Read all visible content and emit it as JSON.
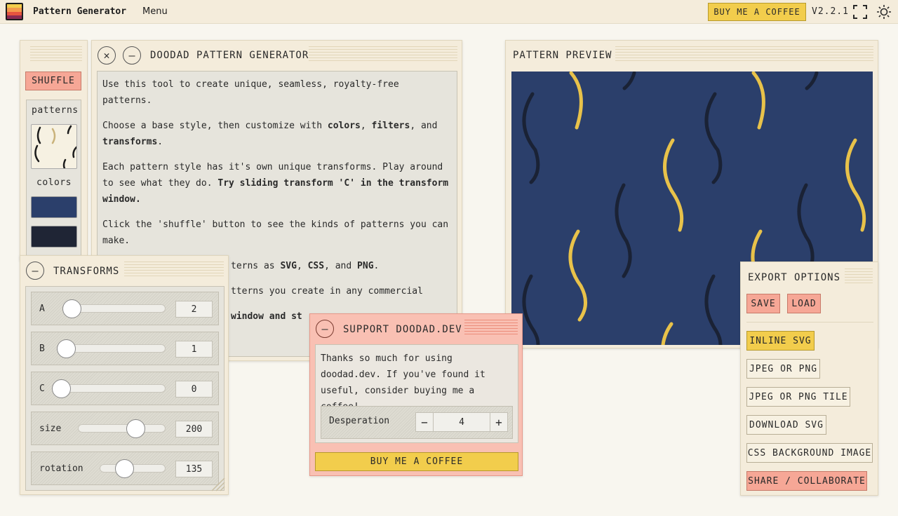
{
  "topbar": {
    "app_title": "Pattern Generator",
    "menu_label": "Menu",
    "coffee_label": "BUY ME A COFFEE",
    "version": "V2.2.1",
    "logo_colors": [
      "#f2cd4c",
      "#f29a4c",
      "#e5543f",
      "#8b2b52"
    ],
    "icons": [
      "logo-icon",
      "fullscreen-icon",
      "sun-icon"
    ]
  },
  "sidebar": {
    "shuffle_label": "SHUFFLE",
    "patterns_label": "patterns",
    "colors_label": "colors",
    "swatches": [
      "#2b3f6b",
      "#1f2535"
    ]
  },
  "generator": {
    "title": "DOODAD PATTERN GENERATOR",
    "para1": "Use this tool to create unique, seamless, royalty-free patterns.",
    "para2_pre": "Choose a base style, then customize with ",
    "para2_b1": "colors",
    "para2_mid1": ", ",
    "para2_b2": "filters",
    "para2_mid2": ", and ",
    "para2_b3": "transforms",
    "para2_end": ".",
    "para3_pre": "Each pattern style has it's own unique transforms. Play around to see what they do. ",
    "para3_b": "Try sliding transform 'C' in the transform window.",
    "para4": "Click the 'shuffle' button to see the kinds of patterns you can make.",
    "para5_pre": "terns as ",
    "para5_b1": "SVG",
    "para5_m1": ", ",
    "para5_b2": "CSS",
    "para5_m2": ", and ",
    "para5_b3": "PNG",
    "para5_end": ".",
    "para6": "tterns you create in any commercial",
    "para7_b": "window and st"
  },
  "transforms": {
    "title": "TRANSFORMS",
    "rows": [
      {
        "label": "A",
        "value": "2",
        "level": 0.1
      },
      {
        "label": "B",
        "value": "1",
        "level": 0.05
      },
      {
        "label": "C",
        "value": "0",
        "level": 0.0
      },
      {
        "label": "size",
        "value": "200",
        "level": 0.65
      },
      {
        "label": "rotation",
        "value": "135",
        "level": 0.37
      }
    ]
  },
  "preview": {
    "title": "PATTERN PREVIEW",
    "bg_color": "#2b3f6b",
    "stroke_a": "#e8c24a",
    "stroke_b": "#1a2235"
  },
  "export": {
    "title": "EXPORT OPTIONS",
    "save_label": "SAVE",
    "load_label": "LOAD",
    "options": [
      "INLINE SVG",
      "JPEG OR PNG",
      "JPEG OR PNG TILE",
      "DOWNLOAD SVG",
      "CSS BACKGROUND IMAGE",
      "SHARE / COLLABORATE"
    ],
    "active_option": "INLINE SVG"
  },
  "support": {
    "title": "SUPPORT DOODAD.DEV",
    "message": "Thanks so much for using doodad.dev. If you've found it useful, consider buying me a coffee!",
    "desperation_label": "Desperation",
    "desperation_value": "4",
    "coffee_label": "BUY ME A COFFEE"
  }
}
